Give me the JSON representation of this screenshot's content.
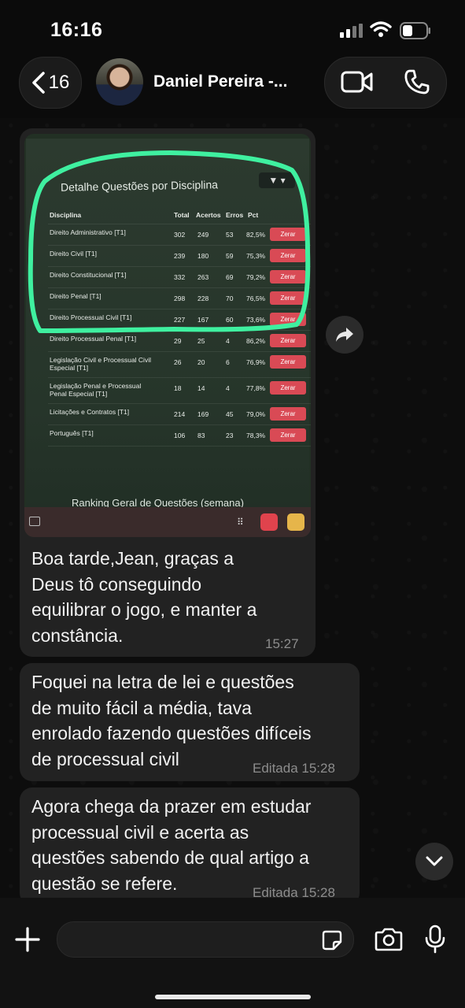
{
  "status_bar": {
    "time": "16:16"
  },
  "header": {
    "back_count": "16",
    "contact_name": "Daniel Pereira -..."
  },
  "photo": {
    "panel_title": "Detalhe Questões por Disciplina",
    "table_headers": [
      "Disciplina",
      "Total",
      "Acertos",
      "Erros",
      "Pct"
    ],
    "rows": [
      {
        "name": "Direito Administrativo [T1]",
        "total": "302",
        "acertos": "249",
        "erros": "53",
        "pct": "82,5%"
      },
      {
        "name": "Direito Civil [T1]",
        "total": "239",
        "acertos": "180",
        "erros": "59",
        "pct": "75,3%"
      },
      {
        "name": "Direito Constitucional [T1]",
        "total": "332",
        "acertos": "263",
        "erros": "69",
        "pct": "79,2%"
      },
      {
        "name": "Direito Penal [T1]",
        "total": "298",
        "acertos": "228",
        "erros": "70",
        "pct": "76,5%"
      },
      {
        "name": "Direito Processual Civil [T1]",
        "total": "227",
        "acertos": "167",
        "erros": "60",
        "pct": "73,6%"
      },
      {
        "name": "Direito Processual Penal [T1]",
        "total": "29",
        "acertos": "25",
        "erros": "4",
        "pct": "86,2%"
      },
      {
        "name": "Legislação Civil e Processual Civil Especial [T1]",
        "total": "26",
        "acertos": "20",
        "erros": "6",
        "pct": "76,9%"
      },
      {
        "name": "Legislação Penal e Processual Penal Especial [T1]",
        "total": "18",
        "acertos": "14",
        "erros": "4",
        "pct": "77,8%"
      },
      {
        "name": "Licitações e Contratos [T1]",
        "total": "214",
        "acertos": "169",
        "erros": "45",
        "pct": "79,0%"
      },
      {
        "name": "Português [T1]",
        "total": "106",
        "acertos": "83",
        "erros": "23",
        "pct": "78,3%"
      }
    ],
    "zerar_label": "Zerar",
    "ranking_title": "Ranking Geral de Questões (semana)"
  },
  "messages": [
    {
      "lines": [
        "Boa tarde,Jean, graças a",
        "Deus tô conseguindo",
        "equilibrar o jogo, e manter a",
        "constância."
      ],
      "time": "15:27"
    },
    {
      "lines": [
        "Foquei na letra de lei e questões",
        "de muito fácil a média, tava",
        "enrolado fazendo questões difíceis",
        "de processual civil"
      ],
      "meta": "Editada  15:28"
    },
    {
      "lines": [
        "Agora chega da prazer em estudar",
        "processual civil e acerta as",
        "questões sabendo de qual artigo a",
        "questão se refere."
      ],
      "meta": "Editada  15:28"
    }
  ],
  "colors": {
    "highlight": "#3ff0a0",
    "zerar": "#d94a55",
    "bubble": "#222222"
  }
}
